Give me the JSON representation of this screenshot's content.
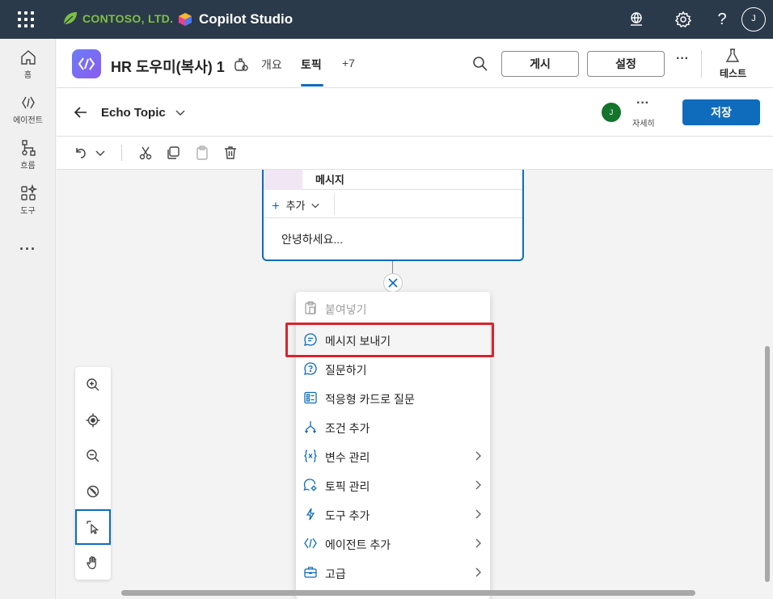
{
  "topbar": {
    "brand": "CONTOSO, LTD.",
    "product": "Copilot Studio",
    "avatar": "J",
    "icons": [
      "waffle-icon",
      "environment-icon",
      "settings-icon",
      "help-icon"
    ]
  },
  "rail": {
    "items": [
      {
        "label": "홈",
        "icon": "home-icon"
      },
      {
        "label": "에이전트",
        "icon": "agent-icon"
      },
      {
        "label": "흐름",
        "icon": "flow-icon"
      },
      {
        "label": "도구",
        "icon": "tools-icon"
      }
    ],
    "more": "···"
  },
  "agent": {
    "name": "HR 도우미(복사) 1",
    "tabs": [
      {
        "label": "개요",
        "active": false
      },
      {
        "label": "토픽",
        "active": true
      },
      {
        "label": "+7",
        "active": false
      }
    ],
    "publish": "게시",
    "settings": "설정",
    "more": "···",
    "test": "테스트"
  },
  "topic": {
    "title": "Echo Topic",
    "avatar": "J",
    "details_more": "···",
    "details": "자세히",
    "save": "저장"
  },
  "node": {
    "title": "메시지",
    "add": "추가",
    "text": "안녕하세요..."
  },
  "menu": {
    "items": [
      {
        "label": "붙여넣기",
        "icon": "paste-icon",
        "disabled": true,
        "submenu": false
      },
      {
        "label": "메시지 보내기",
        "icon": "message-icon",
        "disabled": false,
        "submenu": false,
        "highlighted": true
      },
      {
        "label": "질문하기",
        "icon": "question-icon",
        "disabled": false,
        "submenu": false
      },
      {
        "label": "적응형 카드로 질문",
        "icon": "adaptive-card-icon",
        "disabled": false,
        "submenu": false
      },
      {
        "label": "조건 추가",
        "icon": "condition-icon",
        "disabled": false,
        "submenu": false
      },
      {
        "label": "변수 관리",
        "icon": "variable-icon",
        "disabled": false,
        "submenu": true
      },
      {
        "label": "토픽 관리",
        "icon": "topic-manage-icon",
        "disabled": false,
        "submenu": true
      },
      {
        "label": "도구 추가",
        "icon": "tool-add-icon",
        "disabled": false,
        "submenu": true
      },
      {
        "label": "에이전트 추가",
        "icon": "agent-add-icon",
        "disabled": false,
        "submenu": true
      },
      {
        "label": "고급",
        "icon": "advanced-icon",
        "disabled": false,
        "submenu": true
      }
    ]
  },
  "colors": {
    "topbar": "#2b3a4a",
    "accent": "#0f6cbd",
    "highlight": "#d9232d",
    "avatar_green": "#13742c"
  }
}
